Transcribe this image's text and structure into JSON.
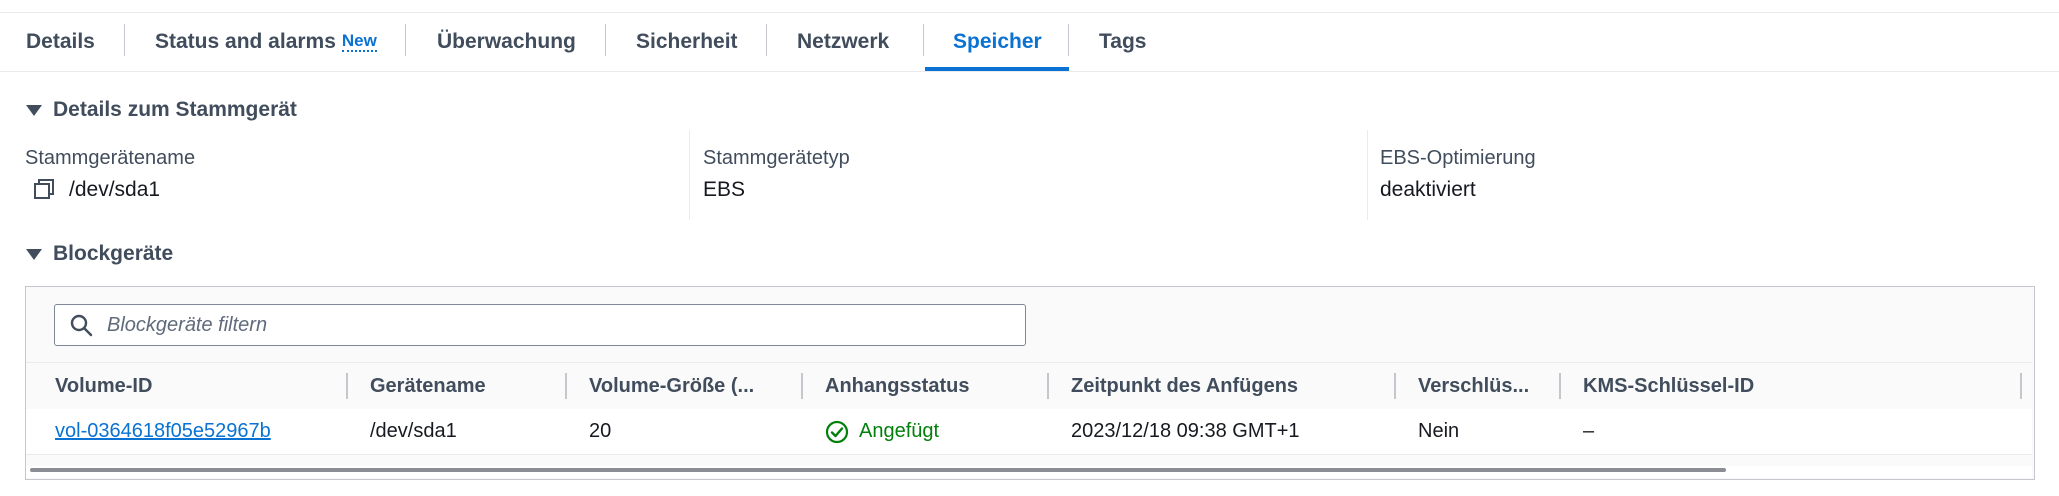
{
  "tabs": [
    {
      "label": "Details"
    },
    {
      "label": "Status and alarms",
      "badge": "New"
    },
    {
      "label": "Überwachung"
    },
    {
      "label": "Sicherheit"
    },
    {
      "label": "Netzwerk"
    },
    {
      "label": "Speicher",
      "active": true
    },
    {
      "label": "Tags"
    }
  ],
  "root_device": {
    "section_title": "Details zum Stammgerät",
    "fields": [
      {
        "label": "Stammgerätename",
        "value": "/dev/sda1"
      },
      {
        "label": "Stammgerätetyp",
        "value": "EBS"
      },
      {
        "label": "EBS-Optimierung",
        "value": "deaktiviert"
      }
    ]
  },
  "block_devices": {
    "section_title": "Blockgeräte",
    "filter_placeholder": "Blockgeräte filtern",
    "columns": [
      "Volume-ID",
      "Gerätename",
      "Volume-Größe (...",
      "Anhangsstatus",
      "Zeitpunkt des Anfügens",
      "Verschlüs...",
      "KMS-Schlüssel-ID"
    ],
    "rows": [
      {
        "volume_id": "vol-0364618f05e52967b",
        "device_name": "/dev/sda1",
        "volume_size": "20",
        "attachment_status": "Angefügt",
        "attach_time": "2023/12/18 09:38 GMT+1",
        "encrypted": "Nein",
        "kms_key_id": "–"
      }
    ]
  },
  "colors": {
    "accent": "#0972d3",
    "success": "#037f0c",
    "text_secondary": "#414d5c"
  }
}
